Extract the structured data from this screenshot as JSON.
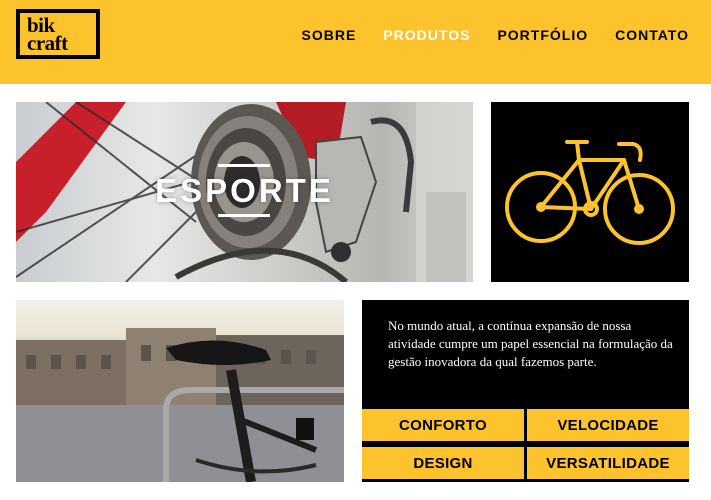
{
  "header": {
    "logo": {
      "line1": "bik",
      "line2": "craft"
    },
    "nav": [
      {
        "label": "SOBRE",
        "active": false
      },
      {
        "label": "PRODUTOS",
        "active": true
      },
      {
        "label": "PORTFÓLIO",
        "active": false
      },
      {
        "label": "CONTATO",
        "active": false
      }
    ]
  },
  "hero": {
    "title": "ESPORTE"
  },
  "icon_box": {
    "icon": "bicycle-icon"
  },
  "photo2": {
    "subject": "bicycle-saddle"
  },
  "info": {
    "text": "No mundo atual, a contínua expansão de nossa atividade cumpre um papel essencial na formulação da gestão inovadora da qual fazemos parte.",
    "tags": [
      "CONFORTO",
      "VELOCIDADE",
      "DESIGN",
      "VERSATILIDADE"
    ]
  },
  "colors": {
    "brand_yellow": "#fcc32c",
    "black": "#000000",
    "white": "#ffffff"
  }
}
